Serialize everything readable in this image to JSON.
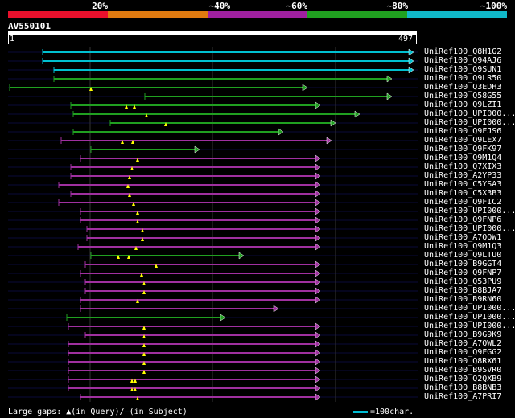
{
  "legend": {
    "segments": [
      {
        "color": "#e8102c"
      },
      {
        "color": "#e07a10"
      },
      {
        "color": "#a020a0"
      },
      {
        "color": "#20a020"
      },
      {
        "color": "#10b8c8"
      }
    ],
    "labels": [
      "20%",
      "~40%",
      "~60%",
      "~80%",
      "~100%"
    ]
  },
  "query": {
    "name": "AV550101",
    "start": "1",
    "end": "497"
  },
  "colors": {
    "cyan": "#00c0d0",
    "green": "#20a020",
    "magenta": "#a030a0",
    "gap": "#ffff00"
  },
  "hits": [
    {
      "name": "UniRef100_Q8H1G2",
      "color": "cyan",
      "s": 53,
      "e": 514,
      "arrow": true,
      "gaps": []
    },
    {
      "name": "UniRef100_Q94AJ6",
      "color": "cyan",
      "s": 53,
      "e": 514,
      "arrow": true,
      "gaps": []
    },
    {
      "name": "UniRef100_Q9SUN1",
      "color": "cyan",
      "s": 67,
      "e": 514,
      "arrow": true,
      "gaps": []
    },
    {
      "name": "UniRef100_Q9LR50",
      "color": "green",
      "s": 67,
      "e": 487,
      "arrow": true,
      "gaps": []
    },
    {
      "name": "UniRef100_Q3EDH3",
      "color": "green",
      "s": 12,
      "e": 382,
      "arrow": true,
      "gaps": [
        113
      ]
    },
    {
      "name": "UniRef100_Q58G55",
      "color": "green",
      "s": 180,
      "e": 487,
      "arrow": true,
      "gaps": []
    },
    {
      "name": "UniRef100_Q9LZI1",
      "color": "green",
      "s": 88,
      "e": 398,
      "arrow": true,
      "gaps": [
        157,
        167
      ]
    },
    {
      "name": "UniRef100_UPI000...",
      "color": "green",
      "s": 91,
      "e": 447,
      "arrow": true,
      "gaps": [
        182
      ]
    },
    {
      "name": "UniRef100_UPI000...",
      "color": "green",
      "s": 137,
      "e": 417,
      "arrow": true,
      "gaps": [
        206
      ]
    },
    {
      "name": "UniRef100_Q9FJS6",
      "color": "green",
      "s": 91,
      "e": 352,
      "arrow": true,
      "gaps": []
    },
    {
      "name": "UniRef100_Q9LEX7",
      "color": "magenta",
      "s": 76,
      "e": 412,
      "arrow": true,
      "gaps": [
        152,
        165
      ]
    },
    {
      "name": "UniRef100_Q9FK97",
      "color": "green",
      "s": 113,
      "e": 248,
      "arrow": true,
      "gaps": []
    },
    {
      "name": "UniRef100_Q9M1Q4",
      "color": "magenta",
      "s": 100,
      "e": 398,
      "arrow": true,
      "gaps": [
        171
      ]
    },
    {
      "name": "UniRef100_Q7XIX3",
      "color": "magenta",
      "s": 88,
      "e": 398,
      "arrow": true,
      "gaps": [
        164
      ]
    },
    {
      "name": "UniRef100_A2YP33",
      "color": "magenta",
      "s": 88,
      "e": 398,
      "arrow": true,
      "gaps": [
        161
      ]
    },
    {
      "name": "UniRef100_C5YSA3",
      "color": "magenta",
      "s": 73,
      "e": 398,
      "arrow": true,
      "gaps": [
        159
      ]
    },
    {
      "name": "UniRef100_C5X3B3",
      "color": "magenta",
      "s": 88,
      "e": 398,
      "arrow": true,
      "gaps": [
        161
      ]
    },
    {
      "name": "UniRef100_Q9FIC2",
      "color": "magenta",
      "s": 73,
      "e": 398,
      "arrow": true,
      "gaps": [
        166
      ]
    },
    {
      "name": "UniRef100_UPI000...",
      "color": "magenta",
      "s": 100,
      "e": 398,
      "arrow": true,
      "gaps": [
        171
      ]
    },
    {
      "name": "UniRef100_Q9FNP6",
      "color": "magenta",
      "s": 100,
      "e": 398,
      "arrow": true,
      "gaps": [
        171
      ]
    },
    {
      "name": "UniRef100_UPI000...",
      "color": "magenta",
      "s": 108,
      "e": 398,
      "arrow": true,
      "gaps": [
        177
      ]
    },
    {
      "name": "UniRef100_A7QQW1",
      "color": "magenta",
      "s": 108,
      "e": 398,
      "arrow": true,
      "gaps": [
        177
      ]
    },
    {
      "name": "UniRef100_Q9M1Q3",
      "color": "magenta",
      "s": 97,
      "e": 398,
      "arrow": true,
      "gaps": [
        169
      ]
    },
    {
      "name": "UniRef100_Q9LTU0",
      "color": "green",
      "s": 113,
      "e": 303,
      "arrow": true,
      "gaps": [
        147,
        160
      ]
    },
    {
      "name": "UniRef100_B9GGT4",
      "color": "magenta",
      "s": 106,
      "e": 398,
      "arrow": true,
      "gaps": [
        194
      ]
    },
    {
      "name": "UniRef100_Q9FNP7",
      "color": "magenta",
      "s": 100,
      "e": 398,
      "arrow": true,
      "gaps": [
        176
      ]
    },
    {
      "name": "UniRef100_Q53PU9",
      "color": "magenta",
      "s": 106,
      "e": 398,
      "arrow": true,
      "gaps": [
        179
      ]
    },
    {
      "name": "UniRef100_B8BJA7",
      "color": "magenta",
      "s": 106,
      "e": 398,
      "arrow": true,
      "gaps": [
        179
      ]
    },
    {
      "name": "UniRef100_B9RN60",
      "color": "magenta",
      "s": 100,
      "e": 398,
      "arrow": true,
      "gaps": [
        171
      ]
    },
    {
      "name": "UniRef100_UPI000...",
      "color": "magenta",
      "s": 100,
      "e": 346,
      "arrow": true,
      "gaps": []
    },
    {
      "name": "UniRef100_UPI000...",
      "color": "green",
      "s": 83,
      "e": 280,
      "arrow": true,
      "gaps": []
    },
    {
      "name": "UniRef100_UPI000...",
      "color": "magenta",
      "s": 85,
      "e": 398,
      "arrow": true,
      "gaps": [
        179
      ]
    },
    {
      "name": "UniRef100_B9G9K9",
      "color": "magenta",
      "s": 106,
      "e": 398,
      "arrow": true,
      "gaps": [
        179
      ]
    },
    {
      "name": "UniRef100_A7QWL2",
      "color": "magenta",
      "s": 85,
      "e": 398,
      "arrow": true,
      "gaps": [
        179
      ]
    },
    {
      "name": "UniRef100_Q9FGG2",
      "color": "magenta",
      "s": 85,
      "e": 398,
      "arrow": true,
      "gaps": [
        179
      ]
    },
    {
      "name": "UniRef100_Q8RX61",
      "color": "magenta",
      "s": 85,
      "e": 398,
      "arrow": true,
      "gaps": [
        179
      ]
    },
    {
      "name": "UniRef100_B9SVR0",
      "color": "magenta",
      "s": 85,
      "e": 398,
      "arrow": true,
      "gaps": [
        179
      ]
    },
    {
      "name": "UniRef100_Q2QXB9",
      "color": "magenta",
      "s": 85,
      "e": 398,
      "arrow": true,
      "gaps": [
        164,
        168
      ]
    },
    {
      "name": "UniRef100_B8BNB3",
      "color": "magenta",
      "s": 85,
      "e": 398,
      "arrow": true,
      "gaps": [
        164,
        168
      ]
    },
    {
      "name": "UniRef100_A7PRI7",
      "color": "magenta",
      "s": 100,
      "e": 398,
      "arrow": true,
      "gaps": [
        171
      ]
    }
  ],
  "footer": {
    "large_gaps": "Large gaps:",
    "in_query": "(in Query)/",
    "in_subject": "(in Subject)",
    "scale": "=100char."
  }
}
